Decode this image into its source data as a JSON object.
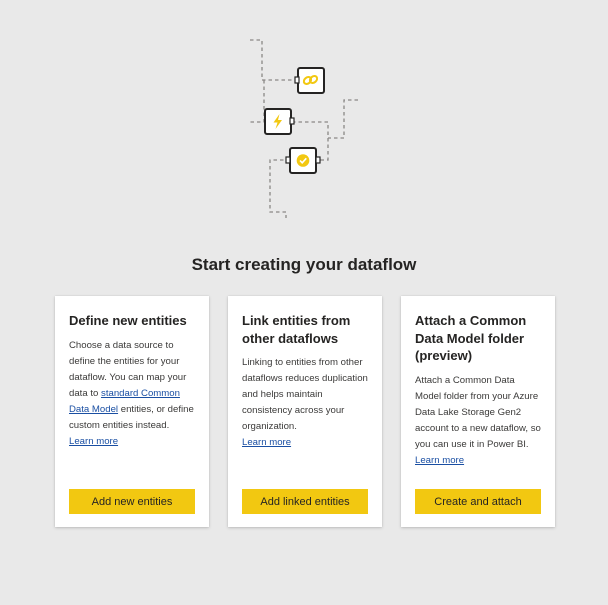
{
  "page": {
    "title": "Start creating your dataflow"
  },
  "illustration": {
    "icons": [
      "link-icon",
      "lightning-icon",
      "check-badge-icon"
    ],
    "accent_color": "#f2c811"
  },
  "cards": [
    {
      "title": "Define new entities",
      "body_before_link": "Choose a data source to define the entities for your dataflow. You can map your data to ",
      "inline_link": "standard Common Data Model",
      "body_after_link": " entities, or define custom entities instead.",
      "learn_more": "Learn more",
      "button": "Add new entities"
    },
    {
      "title": "Link entities from other dataflows",
      "body": "Linking to entities from other dataflows reduces duplication and helps maintain consistency across your organization.",
      "learn_more": "Learn more",
      "button": "Add linked entities"
    },
    {
      "title": "Attach a Common Data Model folder (preview)",
      "body": "Attach a Common Data Model folder from your Azure Data Lake Storage Gen2 account to a new dataflow, so you can use it in Power BI.",
      "learn_more": "Learn more",
      "button": "Create and attach"
    }
  ],
  "colors": {
    "background": "#e9e9e9",
    "button": "#f2c811",
    "link": "#1a4fa3"
  }
}
